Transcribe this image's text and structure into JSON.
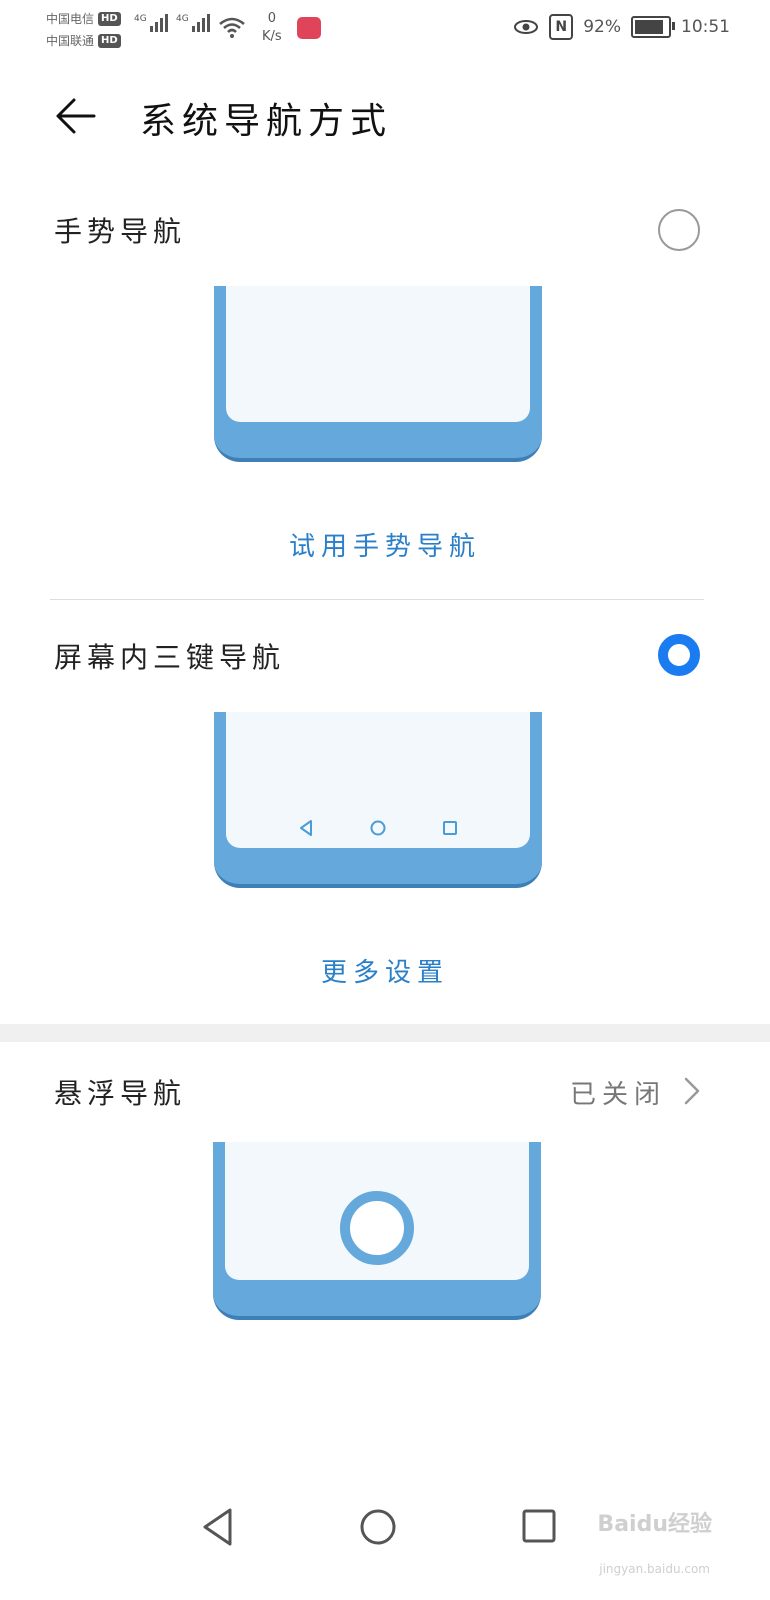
{
  "status_bar": {
    "carrier1": "中国电信",
    "carrier2": "中国联通",
    "hd": "HD",
    "network1": "4G",
    "network2": "4G",
    "speed_value": "0",
    "speed_unit": "K/s",
    "battery": "92%",
    "time": "10:51",
    "nfc": "N"
  },
  "header": {
    "title": "系统导航方式"
  },
  "sections": {
    "gesture": {
      "label": "手势导航",
      "selected": false,
      "link": "试用手势导航"
    },
    "three_key": {
      "label": "屏幕内三键导航",
      "selected": true,
      "link": "更多设置"
    },
    "floating": {
      "label": "悬浮导航",
      "status": "已关闭"
    }
  },
  "colors": {
    "accent": "#1a7cf0",
    "link": "#2a7fc9",
    "illustration": "#64a8dc"
  },
  "watermark": {
    "main": "Baidu经验",
    "sub": "jingyan.baidu.com"
  }
}
